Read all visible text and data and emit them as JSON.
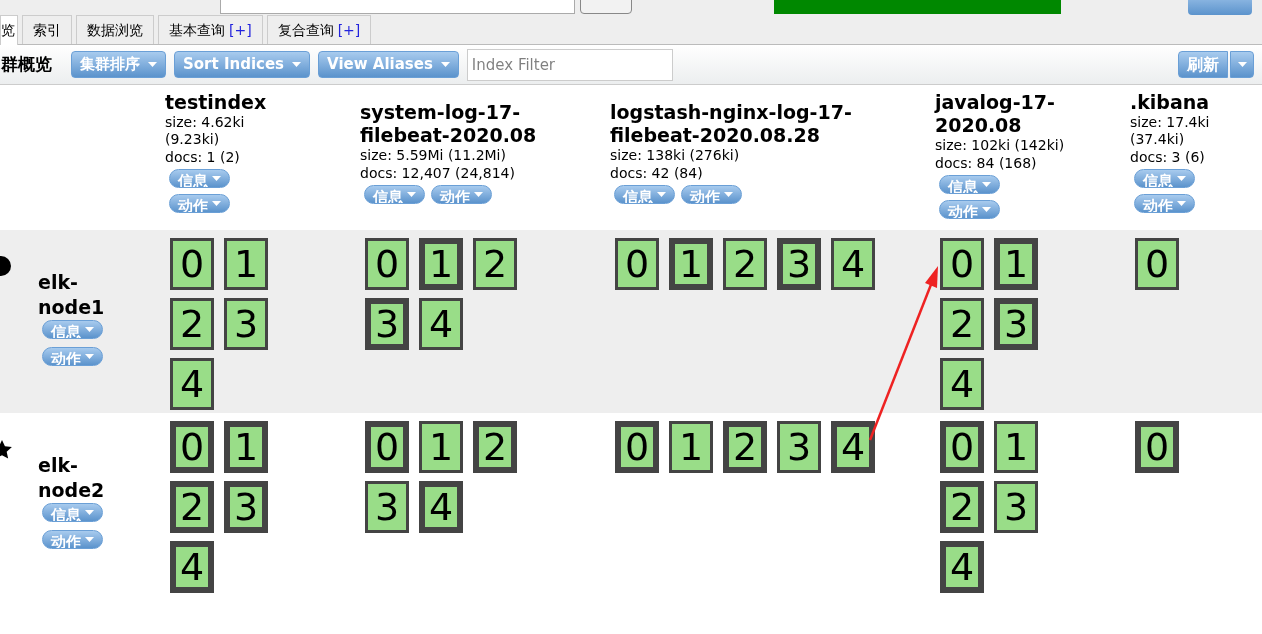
{
  "tabs": [
    {
      "label": "览",
      "selected": true
    },
    {
      "label": "索引",
      "selected": false
    },
    {
      "label": "数据浏览",
      "selected": false
    },
    {
      "label": "基本查询",
      "plus": "[+]",
      "selected": false
    },
    {
      "label": "复合查询",
      "plus": "[+]",
      "selected": false
    }
  ],
  "toolbar": {
    "title": "群概览",
    "buttons": [
      "集群排序",
      "Sort Indices",
      "View Aliases"
    ],
    "filter_placeholder": "Index Filter",
    "refresh_button": "刷新"
  },
  "indices": [
    {
      "name": "testindex",
      "size": "size: 4.62ki (9.23ki)",
      "docs": "docs: 1 (2)",
      "buttons": [
        "信息",
        "动作"
      ]
    },
    {
      "name": "system-log-17-filebeat-2020.08",
      "size": "size: 5.59Mi (11.2Mi)",
      "docs": "docs: 12,407 (24,814)",
      "buttons": [
        "信息",
        "动作"
      ]
    },
    {
      "name": "logstash-nginx-log-17-filebeat-2020.08.28",
      "size": "size: 138ki (276ki)",
      "docs": "docs: 42 (84)",
      "buttons": [
        "信息",
        "动作"
      ]
    },
    {
      "name": "javalog-17-2020.08",
      "size": "size: 102ki (142ki)",
      "docs": "docs: 84 (168)",
      "buttons": [
        "信息",
        "动作"
      ]
    },
    {
      "name": ".kibana",
      "size": "size: 17.4ki (37.4ki)",
      "docs": "docs: 3 (6)",
      "buttons": [
        "信息",
        "动作"
      ]
    }
  ],
  "nodes": [
    {
      "name": "elk-node1",
      "master": false,
      "buttons": [
        "信息",
        "动作"
      ],
      "shards": [
        [
          {
            "label": "0",
            "primary": false
          },
          {
            "label": "1",
            "primary": false
          },
          {
            "label": "2",
            "primary": false
          },
          {
            "label": "3",
            "primary": false
          },
          {
            "label": "4",
            "primary": false
          }
        ],
        [
          {
            "label": "0",
            "primary": false
          },
          {
            "label": "1",
            "primary": true
          },
          {
            "label": "2",
            "primary": false
          },
          {
            "label": "3",
            "primary": true
          },
          {
            "label": "4",
            "primary": false
          }
        ],
        [
          {
            "label": "0",
            "primary": false
          },
          {
            "label": "1",
            "primary": true
          },
          {
            "label": "2",
            "primary": false
          },
          {
            "label": "3",
            "primary": true
          },
          {
            "label": "4",
            "primary": false
          }
        ],
        [
          {
            "label": "0",
            "primary": false
          },
          {
            "label": "1",
            "primary": true
          },
          {
            "label": "2",
            "primary": false
          },
          {
            "label": "3",
            "primary": true
          },
          {
            "label": "4",
            "primary": false
          }
        ],
        [
          {
            "label": "0",
            "primary": false
          }
        ]
      ]
    },
    {
      "name": "elk-node2",
      "master": true,
      "buttons": [
        "信息",
        "动作"
      ],
      "shards": [
        [
          {
            "label": "0",
            "primary": true
          },
          {
            "label": "1",
            "primary": true
          },
          {
            "label": "2",
            "primary": true
          },
          {
            "label": "3",
            "primary": true
          },
          {
            "label": "4",
            "primary": true
          }
        ],
        [
          {
            "label": "0",
            "primary": true
          },
          {
            "label": "1",
            "primary": false
          },
          {
            "label": "2",
            "primary": true
          },
          {
            "label": "3",
            "primary": false
          },
          {
            "label": "4",
            "primary": true
          }
        ],
        [
          {
            "label": "0",
            "primary": true
          },
          {
            "label": "1",
            "primary": false
          },
          {
            "label": "2",
            "primary": true
          },
          {
            "label": "3",
            "primary": false
          },
          {
            "label": "4",
            "primary": true
          }
        ],
        [
          {
            "label": "0",
            "primary": true
          },
          {
            "label": "1",
            "primary": false
          },
          {
            "label": "2",
            "primary": true
          },
          {
            "label": "3",
            "primary": false
          },
          {
            "label": "4",
            "primary": true
          }
        ],
        [
          {
            "label": "0",
            "primary": true
          }
        ]
      ]
    }
  ]
}
